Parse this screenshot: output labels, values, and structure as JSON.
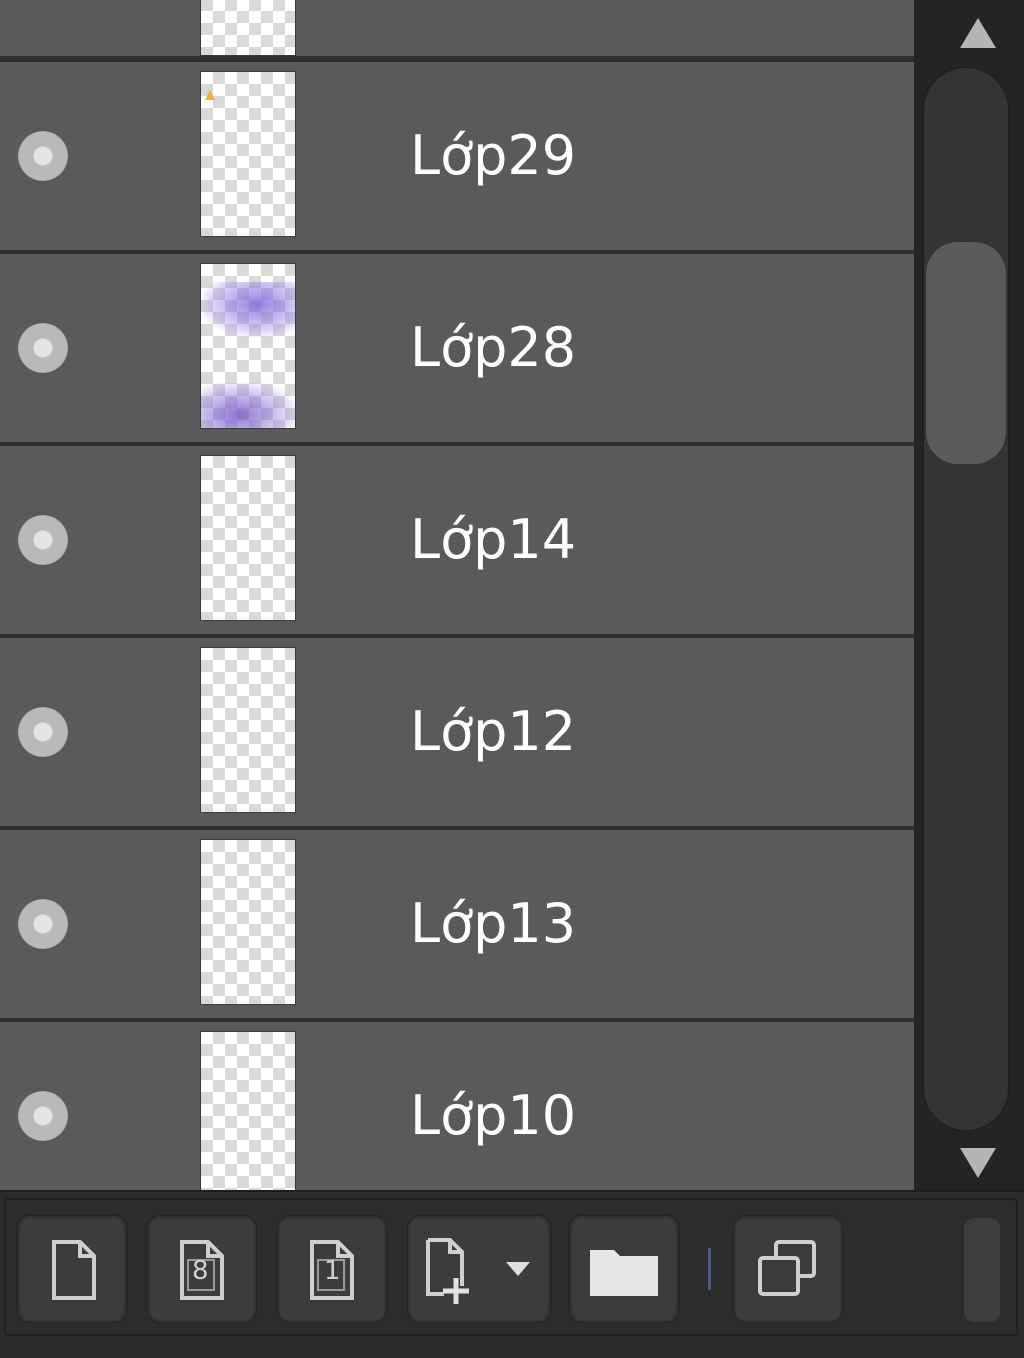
{
  "layers": [
    {
      "name": "Lớp29",
      "thumb": "dot-orange"
    },
    {
      "name": "Lớp28",
      "thumb": "purple-wash"
    },
    {
      "name": "Lớp14",
      "thumb": "blank"
    },
    {
      "name": "Lớp12",
      "thumb": "blank"
    },
    {
      "name": "Lớp13",
      "thumb": "blank"
    },
    {
      "name": "Lớp10",
      "thumb": "blank"
    }
  ],
  "visibility_icon": "eye-dot-icon",
  "toolbar": {
    "new_raster_layer": {
      "icon": "new-layer-icon"
    },
    "new_8bit_layer": {
      "icon": "new-8bit-layer-icon",
      "label": "8"
    },
    "new_1bit_layer": {
      "icon": "new-1bit-layer-icon",
      "label": "1"
    },
    "add_layer_menu": {
      "icon": "add-layer-dropdown-icon"
    },
    "new_folder": {
      "icon": "folder-icon"
    },
    "duplicate_layer": {
      "icon": "duplicate-icon"
    }
  },
  "colors": {
    "row_bg": "#5a5a5a",
    "panel_bg": "#2b2b2b",
    "text": "#ffffff",
    "separator": "#4c5a7a"
  }
}
